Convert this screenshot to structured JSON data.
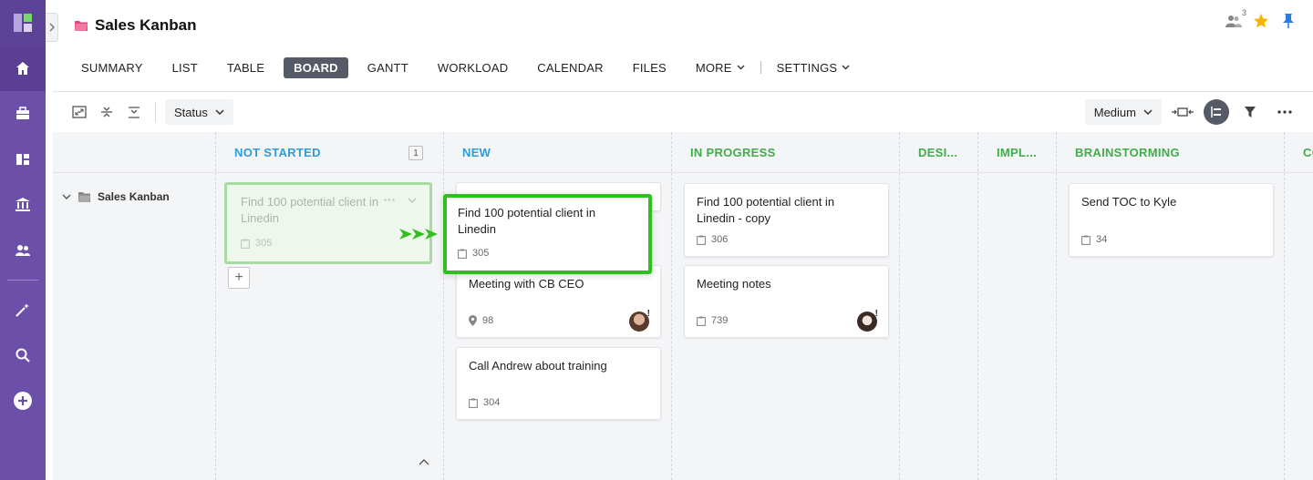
{
  "header": {
    "title": "Sales Kanban",
    "member_count": "3"
  },
  "tabs": [
    {
      "label": "SUMMARY"
    },
    {
      "label": "LIST"
    },
    {
      "label": "TABLE"
    },
    {
      "label": "BOARD"
    },
    {
      "label": "GANTT"
    },
    {
      "label": "WORKLOAD"
    },
    {
      "label": "CALENDAR"
    },
    {
      "label": "FILES"
    },
    {
      "label": "MORE"
    },
    {
      "label": "SETTINGS"
    }
  ],
  "active_tab": "BOARD",
  "toolbar": {
    "group_by": "Status",
    "card_size": "Medium"
  },
  "group": {
    "label": "Sales Kanban"
  },
  "columns": [
    {
      "title": "NOT STARTED",
      "count": "1",
      "color": "#2e9bdb"
    },
    {
      "title": "NEW",
      "color": "#2e9bdb"
    },
    {
      "title": "IN PROGRESS",
      "color": "#3fae49"
    },
    {
      "title": "DESI...",
      "color": "#3fae49"
    },
    {
      "title": "IMPL...",
      "color": "#3fae49"
    },
    {
      "title": "BRAINSTORMING",
      "color": "#3fae49"
    },
    {
      "title": "CO",
      "color": "#3fae49"
    }
  ],
  "cards": {
    "ghost": {
      "title": "Find 100 potential client in Linedin",
      "id": "305"
    },
    "moving": {
      "title": "Find 100 potential client in Linedin",
      "id": "305"
    },
    "new_1": {
      "title": "Meeting with CB CEO",
      "id": "98",
      "flag": "!"
    },
    "new_2": {
      "title": "Call Andrew about training",
      "id": "304"
    },
    "progress_1": {
      "title": "Find 100 potential client in Linedin - copy",
      "id": "306"
    },
    "progress_2": {
      "title": "Meeting notes",
      "id": "739",
      "flag": "!"
    },
    "brainstorm_1": {
      "title": "Send TOC to Kyle",
      "id": "34"
    }
  },
  "colors": {
    "sidebar": "#6b4fa8",
    "drag_highlight": "#2fbf1f",
    "star": "#f5b400",
    "pin": "#2a7de1"
  }
}
